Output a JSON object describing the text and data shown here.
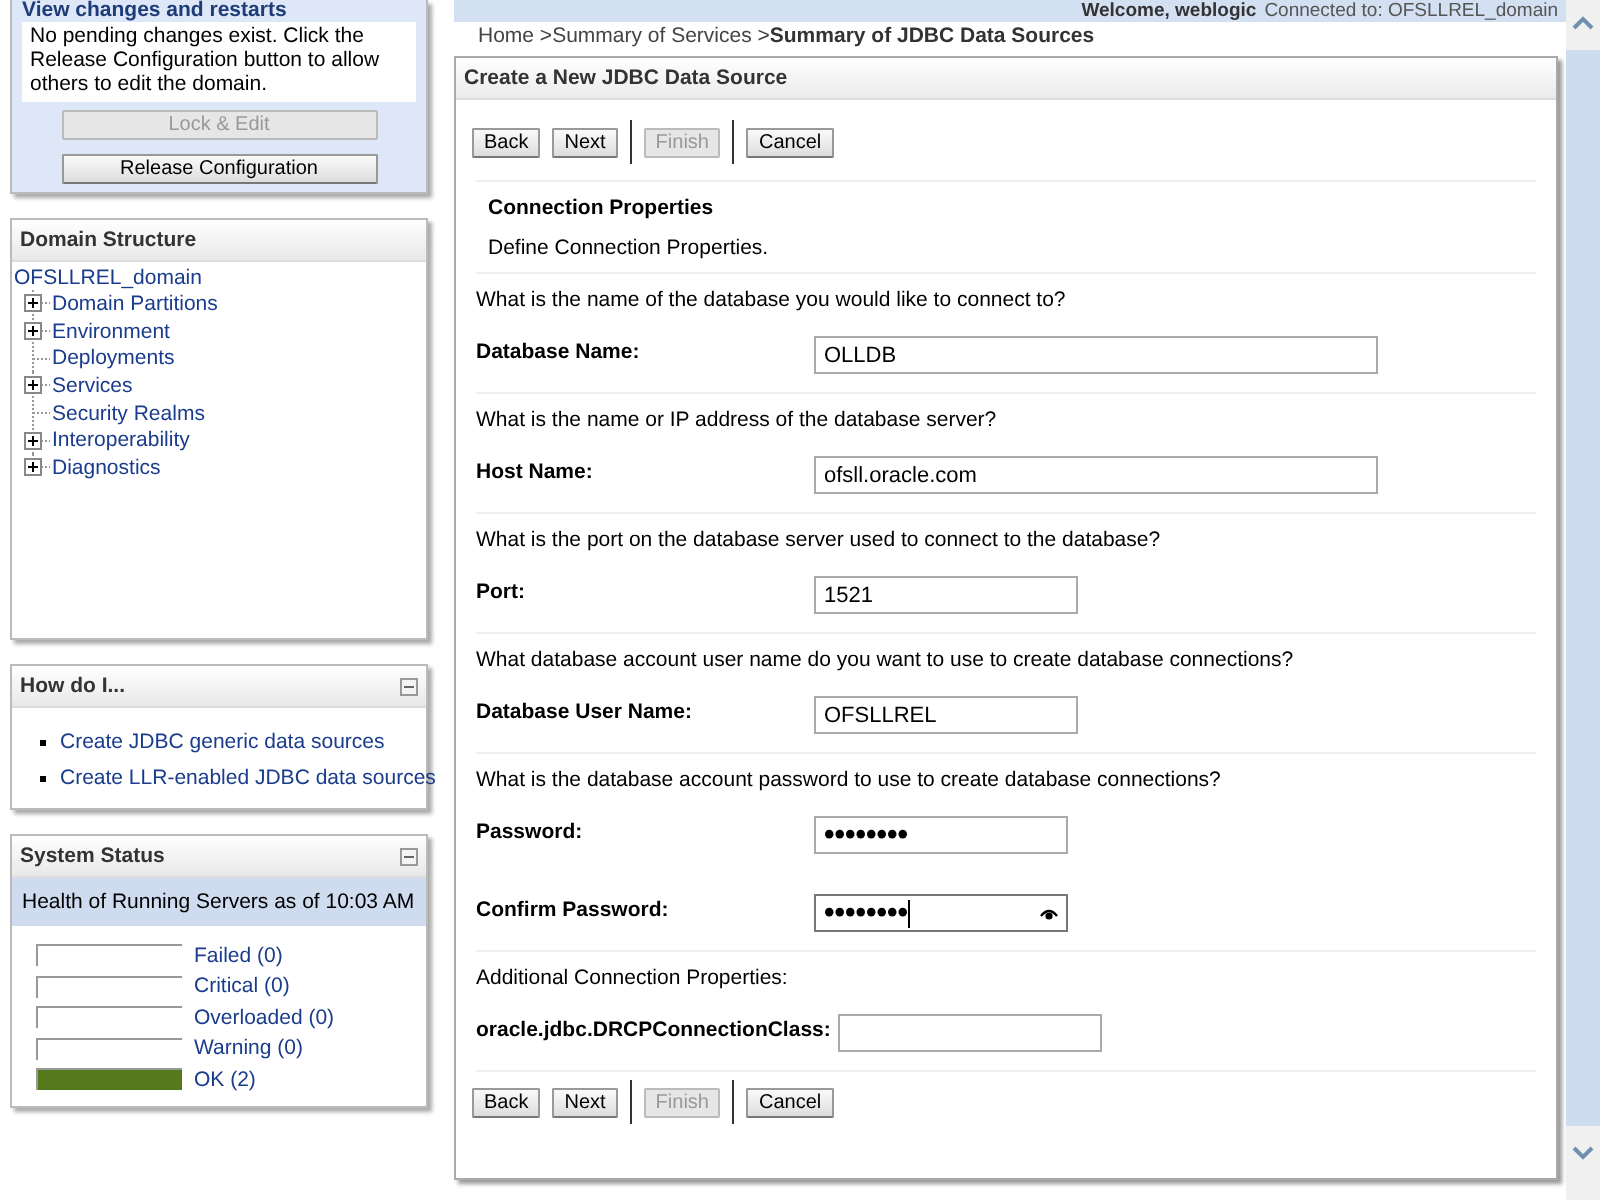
{
  "header": {
    "welcome": "Welcome, weblogic",
    "connected": "Connected to: OFSLLREL_domain"
  },
  "change_center": {
    "title": "View changes and restarts",
    "message": "No pending changes exist. Click the Release Configuration button to allow others to edit the domain.",
    "buttons": [
      {
        "label": "Lock & Edit",
        "disabled": true
      },
      {
        "label": "Release Configuration",
        "disabled": false
      }
    ]
  },
  "domain_structure": {
    "title": "Domain Structure",
    "root": "OFSLLREL_domain",
    "items": [
      {
        "label": "Domain Partitions",
        "expandable": true
      },
      {
        "label": "Environment",
        "expandable": true
      },
      {
        "label": "Deployments",
        "expandable": false
      },
      {
        "label": "Services",
        "expandable": true
      },
      {
        "label": "Security Realms",
        "expandable": false
      },
      {
        "label": "Interoperability",
        "expandable": true
      },
      {
        "label": "Diagnostics",
        "expandable": true
      }
    ]
  },
  "how_do_i": {
    "title": "How do I...",
    "links": [
      "Create JDBC generic data sources",
      "Create LLR-enabled JDBC data sources"
    ]
  },
  "system_status": {
    "title": "System Status",
    "subtitle": "Health of Running Servers as of  10:03 AM",
    "rows": [
      {
        "label": "Failed (0)",
        "level": 0
      },
      {
        "label": "Critical (0)",
        "level": 0
      },
      {
        "label": "Overloaded (0)",
        "level": 0
      },
      {
        "label": "Warning (0)",
        "level": 0
      },
      {
        "label": "OK (2)",
        "level": 1
      }
    ]
  },
  "breadcrumb": [
    {
      "label": "Home >",
      "current": false
    },
    {
      "label": "Summary of Services >",
      "current": false
    },
    {
      "label": "Summary of JDBC Data Sources",
      "current": true
    }
  ],
  "wizard": {
    "title": "Create a New JDBC Data Source",
    "top_buttons": [
      {
        "label": "Back",
        "disabled": false
      },
      {
        "label": "Next",
        "disabled": false
      },
      {
        "label": "Finish",
        "disabled": true
      },
      {
        "label": "Cancel",
        "disabled": false
      }
    ],
    "section_title": "Connection Properties",
    "section_description": "Define Connection Properties.",
    "groups": [
      {
        "question": "What is the name of the database you would like to connect to?",
        "fields": [
          {
            "label": "Database Name:",
            "value": "OLLDB",
            "wide": true,
            "focused": false
          }
        ]
      },
      {
        "question": "What is the name or IP address of the database server?",
        "fields": [
          {
            "label": "Host Name:",
            "value": "ofsll.oracle.com",
            "wide": true,
            "focused": false
          }
        ]
      },
      {
        "question": "What is the port on the database server used to connect to the database?",
        "fields": [
          {
            "label": "Port:",
            "value": "1521",
            "wide": false,
            "focused": false
          }
        ]
      },
      {
        "question": "What database account user name do you want to use to create database connections?",
        "fields": [
          {
            "label": "Database User Name:",
            "value": "OFSLLREL",
            "wide": false,
            "focused": false
          }
        ]
      },
      {
        "question": "What is the database account password to use to create database connections?",
        "fields": [
          {
            "label": "Password:",
            "value": "••••••••",
            "wide": false,
            "focused": false
          },
          {
            "label": "Confirm Password:",
            "value": "••••••••",
            "wide": false,
            "focused": true
          }
        ]
      },
      {
        "question": "Additional Connection Properties:",
        "fields": [
          {
            "label": "oracle.jdbc.DRCPConnectionClass:",
            "wide": false,
            "focused": false
          }
        ]
      }
    ],
    "bottom_buttons": [
      {
        "label": "Back",
        "disabled": false
      },
      {
        "label": "Next",
        "disabled": false
      },
      {
        "label": "Finish",
        "disabled": true
      },
      {
        "label": "Cancel",
        "disabled": false
      }
    ]
  }
}
